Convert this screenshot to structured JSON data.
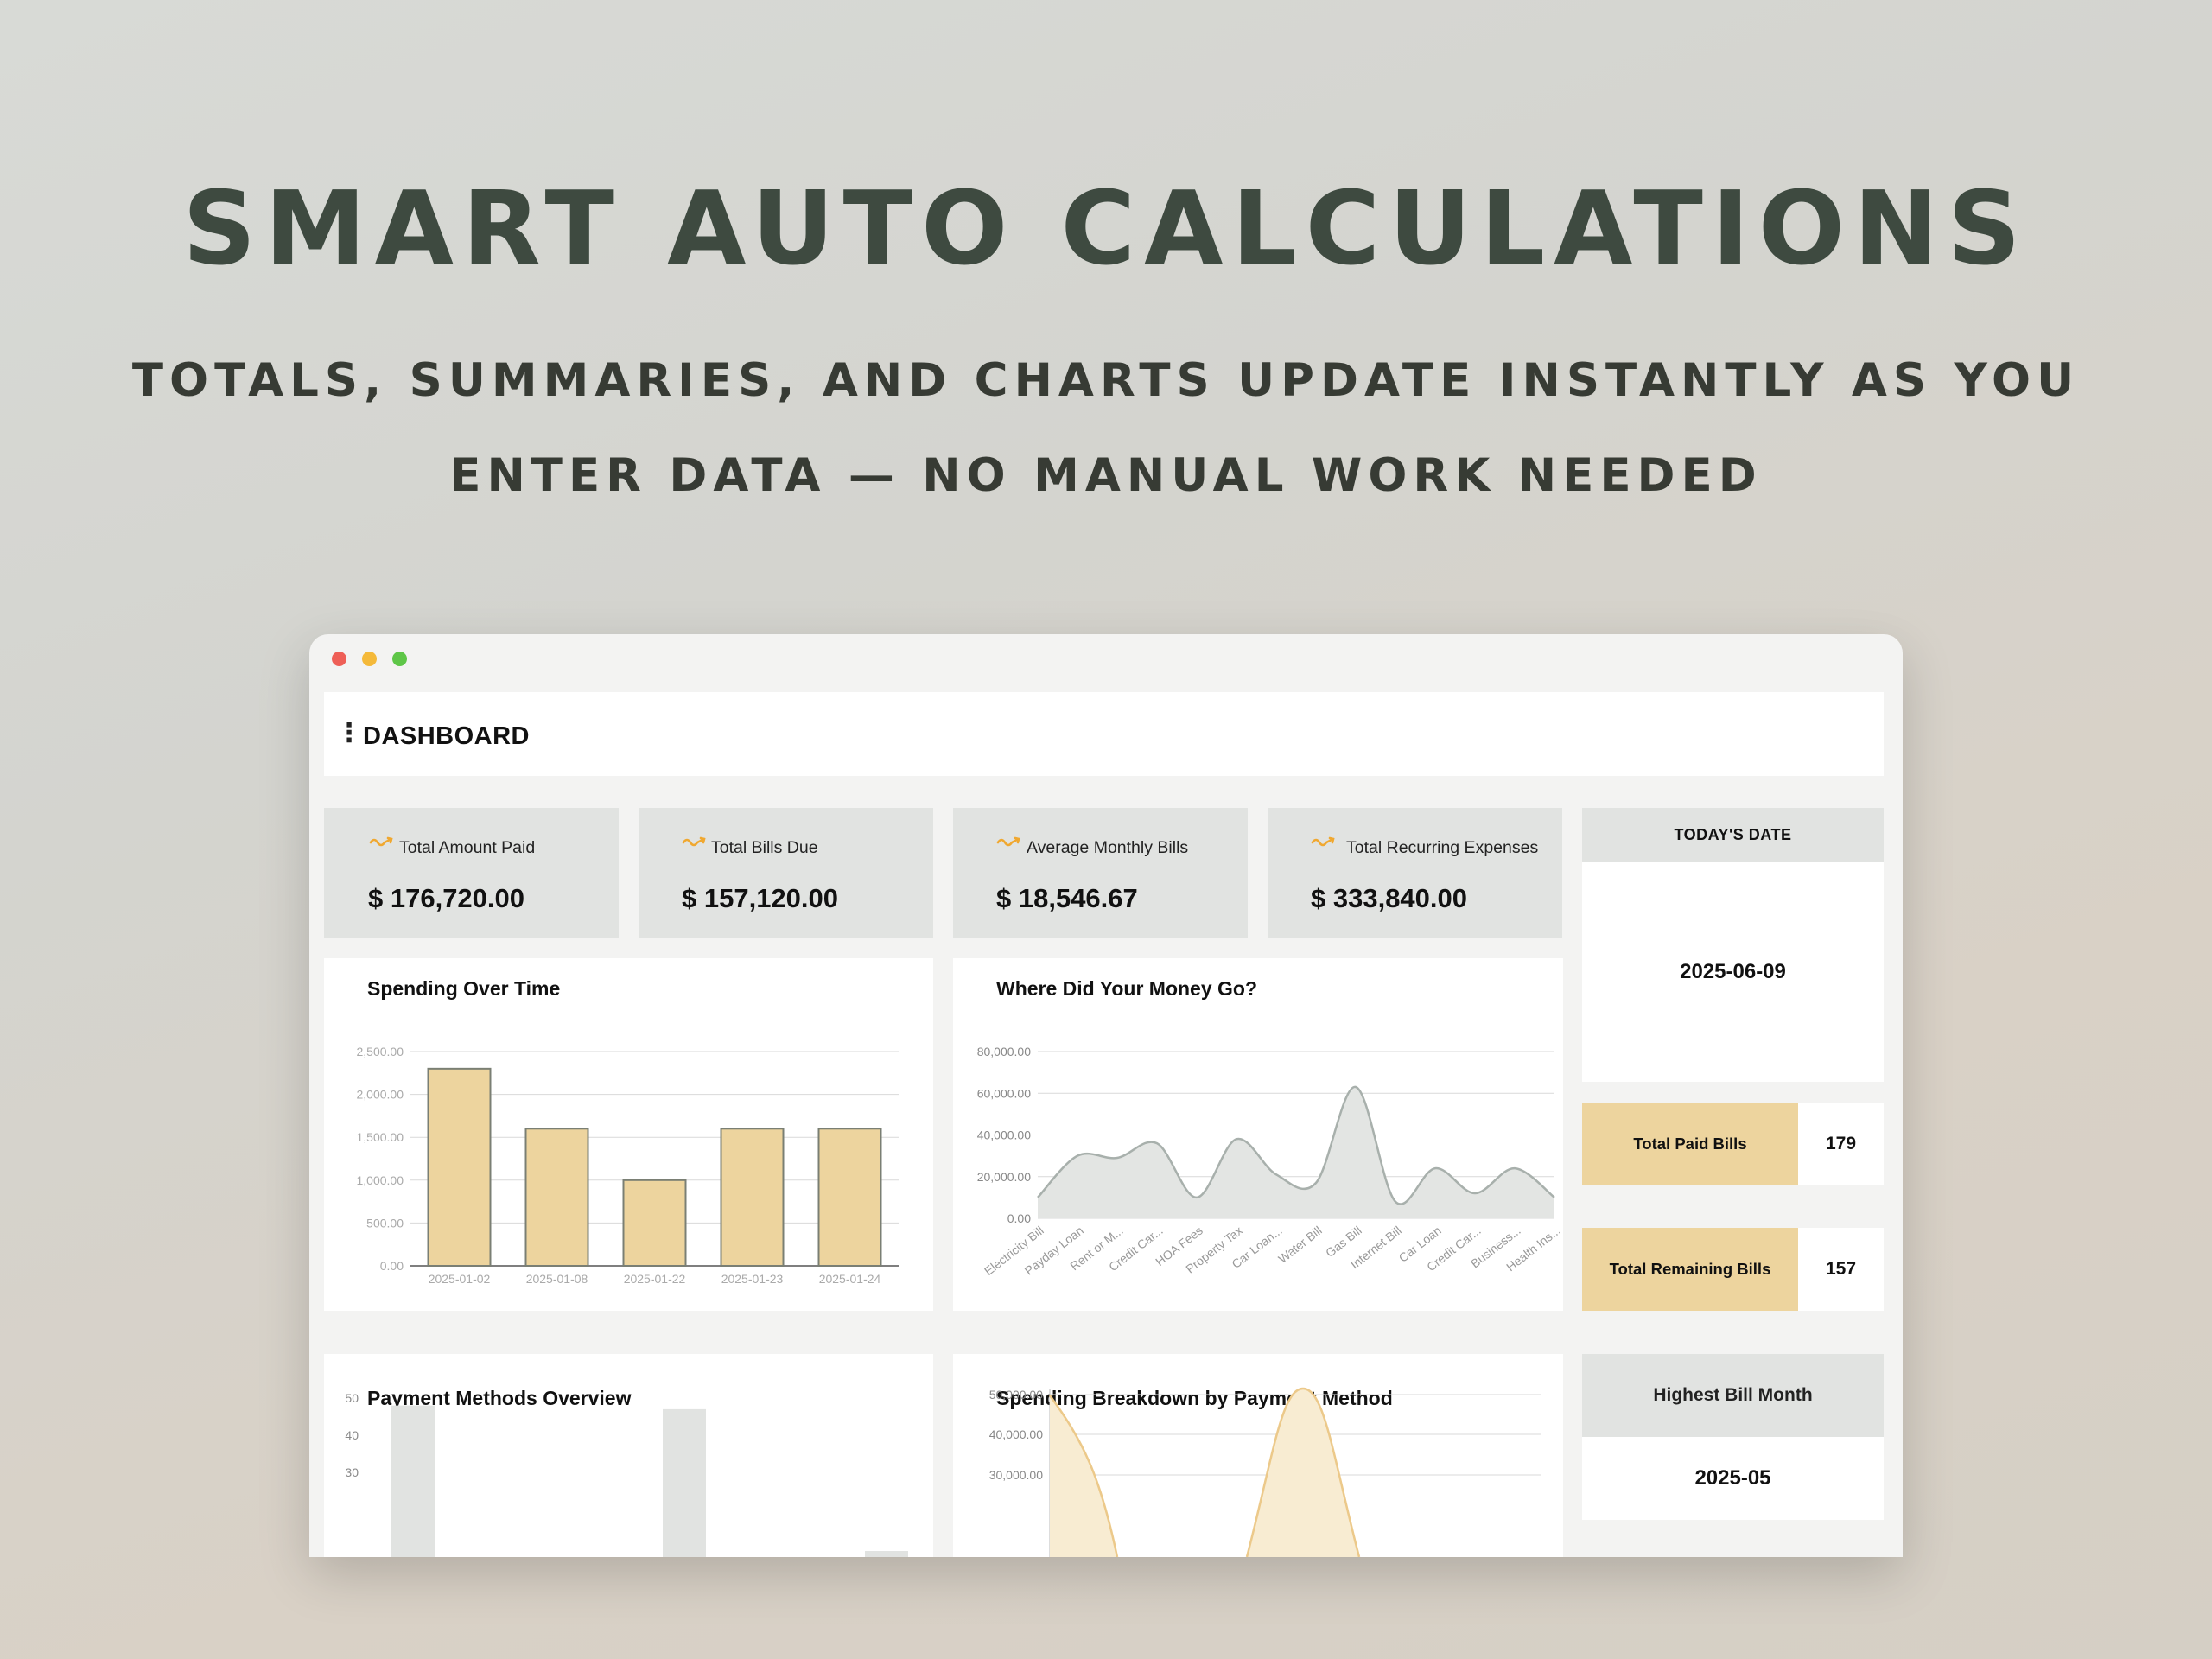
{
  "hero": {
    "title": "SMART AUTO CALCULATIONS",
    "subtitle_line1": "TOTALS, SUMMARIES, AND CHARTS UPDATE INSTANTLY AS YOU",
    "subtitle_line2": "ENTER DATA — NO MANUAL WORK NEEDED"
  },
  "colors": {
    "headline": "#3e4a40",
    "accent": "#edd49e",
    "stat_bg": "#e1e3e1",
    "bar_fill": "#edd49e",
    "bar_stroke": "#7a7f74",
    "area_fill": "#e3e5e3",
    "area_stroke": "#a8b0ac",
    "trend_icon": "#f0a830"
  },
  "window": {
    "controls": [
      "close-dot",
      "minimize-dot",
      "maximize-dot"
    ],
    "menu_icon": "kebab-menu-icon",
    "page_title": "DASHBOARD"
  },
  "stats": [
    {
      "icon": "trend-icon",
      "label": "Total Amount Paid",
      "value": "$ 176,720.00"
    },
    {
      "icon": "trend-icon",
      "label": "Total Bills Due",
      "value": "$ 157,120.00"
    },
    {
      "icon": "trend-icon",
      "label": "Average Monthly Bills",
      "value": "$ 18,546.67"
    },
    {
      "icon": "trend-icon",
      "label": "Total Recurring Expenses",
      "value": "$ 333,840.00"
    }
  ],
  "today": {
    "label": "TODAY'S DATE",
    "value": "2025-06-09"
  },
  "paid_bills": {
    "label": "Total Paid Bills",
    "value": "179"
  },
  "remaining_bills": {
    "label": "Total Remaining Bills",
    "value": "157"
  },
  "highest_month": {
    "label": "Highest Bill Month",
    "value": "2025-05"
  },
  "panels": {
    "spending_over_time": "Spending Over Time",
    "where_money": "Where Did Your Money Go?",
    "payment_methods": "Payment Methods Overview",
    "spending_breakdown": "Spending Breakdown by Payment Method"
  },
  "chart_data": [
    {
      "type": "bar",
      "title": "Spending Over Time",
      "categories": [
        "2025-01-02",
        "2025-01-08",
        "2025-01-22",
        "2025-01-23",
        "2025-01-24"
      ],
      "values": [
        2300,
        1600,
        1000,
        1600,
        1600
      ],
      "ylim": [
        0,
        2500
      ],
      "yticks": [
        "0.00",
        "500.00",
        "1,000.00",
        "1,500.00",
        "2,000.00",
        "2,500.00"
      ],
      "grid": true
    },
    {
      "type": "area",
      "title": "Where Did Your Money Go?",
      "categories": [
        "Electricity Bill",
        "Payday Loan",
        "Rent or M...",
        "Credit Car...",
        "HOA Fees",
        "Property Tax",
        "Car Loan...",
        "Water Bill",
        "Gas Bill",
        "Internet Bill",
        "Car Loan",
        "Credit Car...",
        "Business...",
        "Health Ins..."
      ],
      "values": [
        10000,
        30000,
        29000,
        36000,
        10000,
        38000,
        21000,
        17000,
        63000,
        8000,
        24000,
        12000,
        24000,
        10000
      ],
      "ylim": [
        0,
        80000
      ],
      "yticks": [
        "0.00",
        "20,000.00",
        "40,000.00",
        "60,000.00",
        "80,000.00"
      ],
      "grid": true
    },
    {
      "type": "bar",
      "title": "Payment Methods Overview",
      "values_visible": [
        48,
        47,
        3
      ],
      "yticks": [
        "30",
        "40",
        "50"
      ],
      "grid": false
    },
    {
      "type": "area",
      "title": "Spending Breakdown by Payment Method",
      "yticks": [
        "30,000.00",
        "40,000.00",
        "50,000.00"
      ],
      "grid": true
    }
  ]
}
